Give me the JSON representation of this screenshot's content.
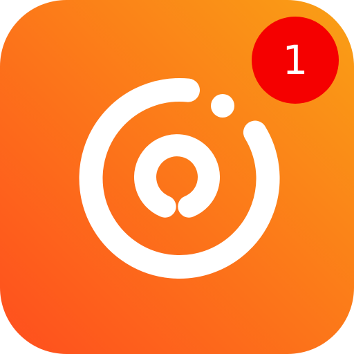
{
  "app_icon": {
    "icon_name": "circular-logo-icon",
    "colors": {
      "gradient_top_right": "#F9A015",
      "gradient_bottom_left": "#FF4E1E",
      "symbol": "#FFFFFF"
    }
  },
  "notification_badge": {
    "count": "1",
    "color": "#F50000",
    "text_color": "#FFFFFF"
  }
}
